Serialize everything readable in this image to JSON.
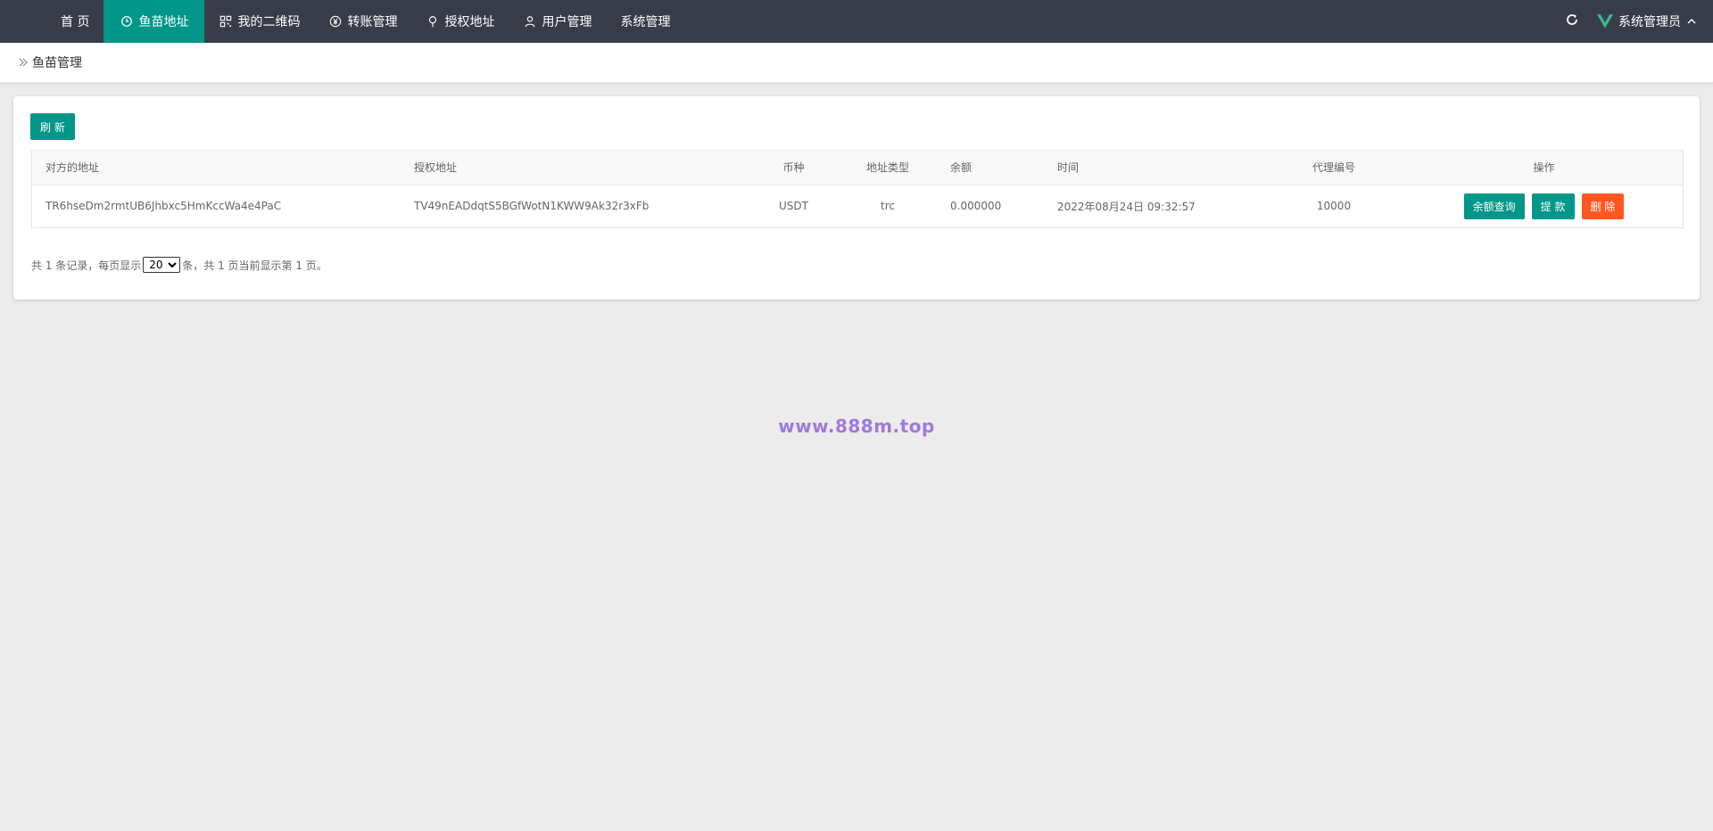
{
  "nav": {
    "items": [
      {
        "label": "首 页",
        "icon": "none",
        "active": false
      },
      {
        "label": "鱼苗地址",
        "icon": "clock-icon",
        "active": true
      },
      {
        "label": "我的二维码",
        "icon": "qr-code-icon",
        "active": false
      },
      {
        "label": "转账管理",
        "icon": "yen-icon",
        "active": false
      },
      {
        "label": "授权地址",
        "icon": "location-pin-icon",
        "active": false
      },
      {
        "label": "用户管理",
        "icon": "user-icon",
        "active": false
      },
      {
        "label": "系统管理",
        "icon": "none",
        "active": false
      }
    ],
    "active_color": "#009688",
    "bar_color": "#393d49"
  },
  "header_right": {
    "refresh_icon": "refresh-icon",
    "user_label": "系统管理员",
    "logo_icon": "vue-logo-icon",
    "caret_icon": "chevron-up-icon"
  },
  "breadcrumb": {
    "icon": "double-chevron-right-icon",
    "text": "鱼苗管理"
  },
  "toolbar": {
    "refresh_label": "刷 新"
  },
  "table": {
    "columns": [
      "对方的地址",
      "授权地址",
      "币种",
      "地址类型",
      "余额",
      "时间",
      "代理编号",
      "操作"
    ],
    "rows": [
      {
        "counterparty_address": "TR6hseDm2rmtUB6Jhbxc5HmKccWa4e4PaC",
        "auth_address": "TV49nEADdqtS5BGfWotN1KWW9Ak32r3xFb",
        "currency": "USDT",
        "address_type": "trc",
        "balance": "0.000000",
        "time": "2022年08月24日 09:32:57",
        "agent_id": "10000",
        "actions": {
          "query_balance": "余额查询",
          "withdraw": "提 款",
          "delete": "删 除"
        }
      }
    ]
  },
  "pagination": {
    "prefix": "共 1 条记录，每页显示",
    "page_size": "20",
    "page_size_options": [
      "20"
    ],
    "suffix": "条，共 1 页当前显示第 1 页。"
  },
  "watermark": "www.888m.top",
  "colors": {
    "primary": "#009688",
    "danger": "#ff5722",
    "watermark": "#a07ad8"
  }
}
